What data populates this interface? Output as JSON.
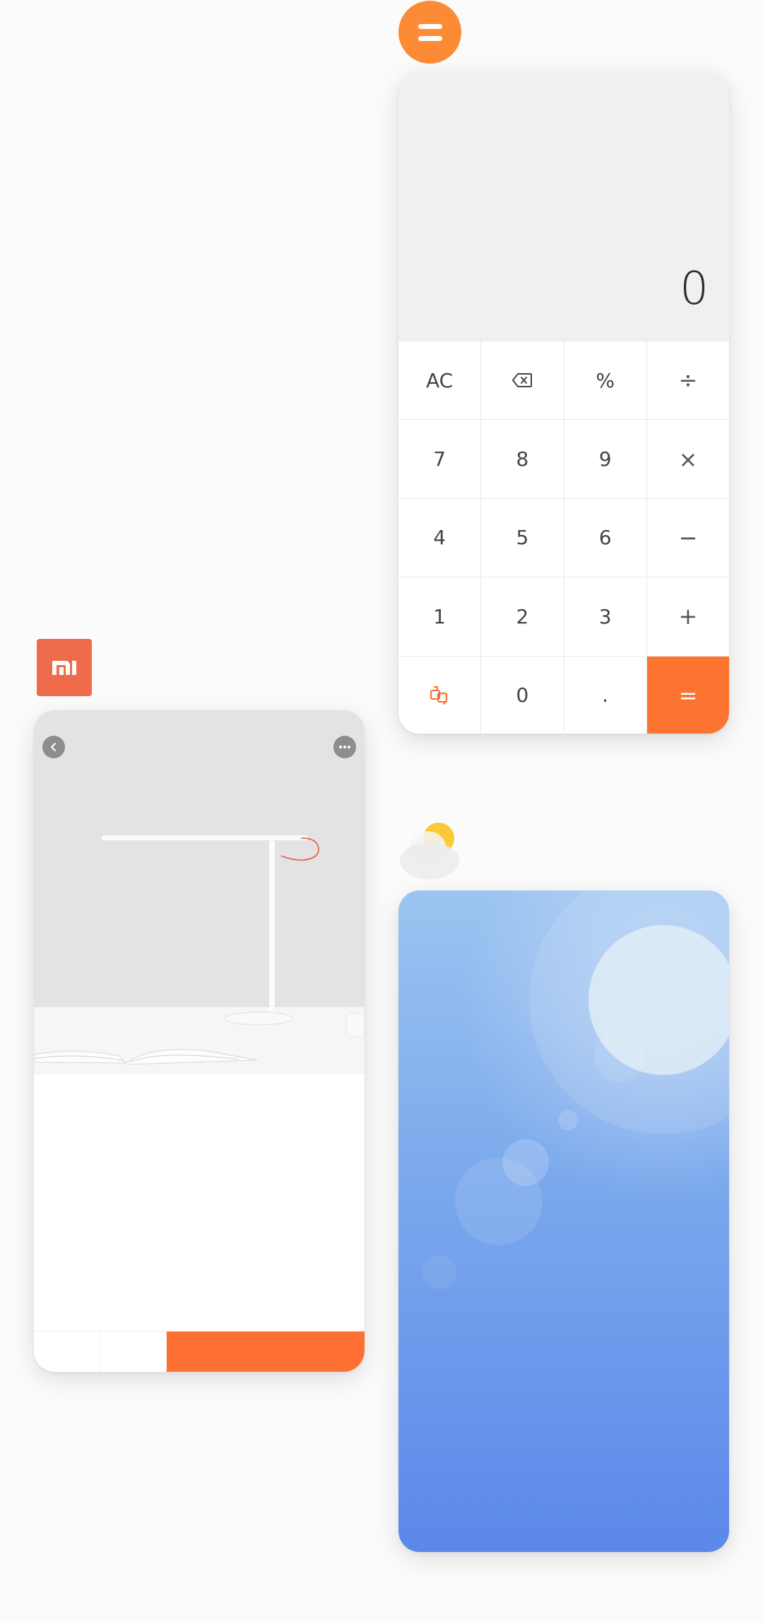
{
  "calculator": {
    "display_value": "0",
    "keys": [
      "AC",
      "⌫",
      "%",
      "÷",
      "7",
      "8",
      "9",
      "×",
      "4",
      "5",
      "6",
      "−",
      "1",
      "2",
      "3",
      "+",
      "⇄",
      "0",
      ".",
      "="
    ],
    "accent_color": "#fd7430"
  },
  "mi_app": {
    "logo_text": "mi",
    "logo_color": "#ee6b4c",
    "buy_bar_color": "#fd7032"
  },
  "weather": {
    "gradient_top": "#9cc4f1",
    "gradient_bottom": "#5b88ea"
  }
}
